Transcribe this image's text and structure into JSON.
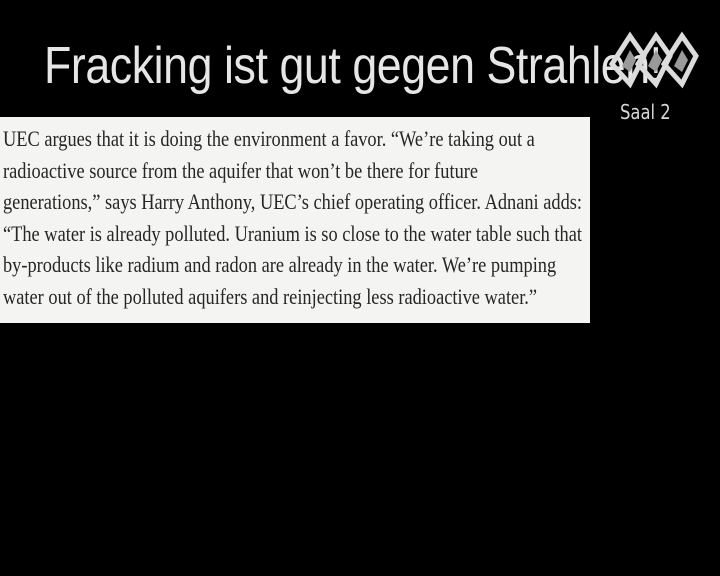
{
  "slide": {
    "title": "Fracking ist gut gegen Strahlen!",
    "room_label": "Saal 2",
    "logo_icon": "conference-logo-icon",
    "quote_lines": [
      "UEC argues that it is doing the environment a favor. “We’re taking out a",
      "radioactive source from the aquifer that won’t be there for future",
      "generations,” says Harry Anthony, UEC’s chief operating officer. Adnani adds:",
      "“The water is already polluted. Uranium is so close to the water table such that",
      "by-products like radium and radon are already in the water. We’re pumping",
      "water out of the polluted aquifers and reinjecting less radioactive water.”"
    ]
  },
  "colors": {
    "background": "#000000",
    "title_text": "#e6e6e6",
    "panel_background": "#f4f4f2",
    "panel_text": "#262626"
  }
}
